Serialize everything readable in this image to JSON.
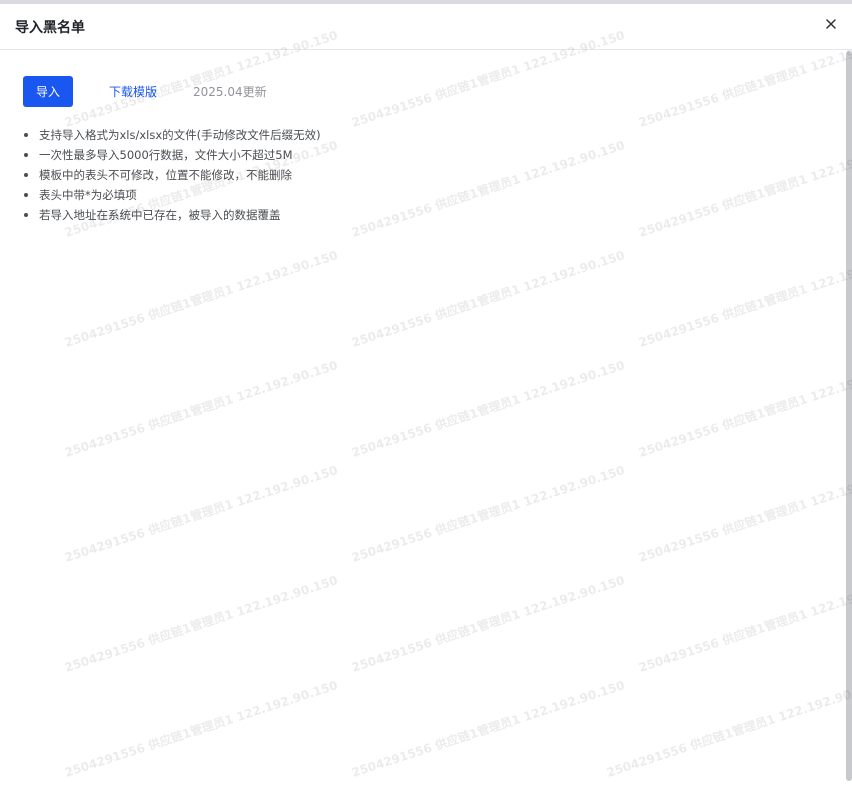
{
  "dialog": {
    "title": "导入黑名单",
    "close_icon": "close-icon"
  },
  "actions": {
    "import_label": "导入",
    "download_template_label": "下载模版",
    "update_note": "2025.04更新"
  },
  "notes": [
    "支持导入格式为xls/xlsx的文件(手动修改文件后缀无效)",
    "一次性最多导入5000行数据，文件大小不超过5M",
    "模板中的表头不可修改，位置不能修改，不能删除",
    "表头中带*为必填项",
    "若导入地址在系统中已存在，被导入的数据覆盖"
  ],
  "watermark": "2504291556 供应链1管理员1 122.192.90.150",
  "colors": {
    "primary": "#1a56f0",
    "scrollbar": "#c7c9cc"
  }
}
